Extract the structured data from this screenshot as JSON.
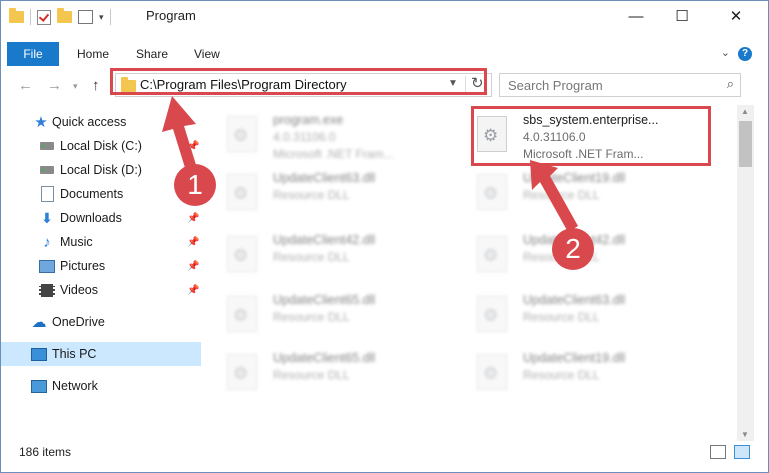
{
  "window": {
    "title": "Program",
    "minimize": "—",
    "maximize": "☐",
    "close": "✕"
  },
  "ribbon": {
    "file": "File",
    "tabs": [
      "Home",
      "Share",
      "View"
    ],
    "help": "?",
    "collapse": "⌄"
  },
  "address": {
    "path": "C:\\Program Files\\Program Directory",
    "search_placeholder": "Search Program"
  },
  "nav": {
    "items": [
      {
        "label": "Quick access"
      },
      {
        "label": "Local Disk (C:)"
      },
      {
        "label": "Local Disk (D:)"
      },
      {
        "label": "Documents"
      },
      {
        "label": "Downloads"
      },
      {
        "label": "Music"
      },
      {
        "label": "Pictures"
      },
      {
        "label": "Videos"
      },
      {
        "label": "OneDrive"
      },
      {
        "label": "This PC"
      },
      {
        "label": "Network"
      }
    ]
  },
  "files": [
    {
      "name": "program.exe",
      "line1": "4.0.31106.0",
      "line2": "Microsoft .NET Fram..."
    },
    {
      "name": "sbs_system.enterprise...",
      "line1": "4.0.31106.0",
      "line2": "Microsoft .NET Fram..."
    },
    {
      "name": "UpdateClient63.dll",
      "line1": "Resource DLL"
    },
    {
      "name": "UpdateClient19.dll",
      "line1": "Resource DLL"
    },
    {
      "name": "UpdateClient42.dll",
      "line1": "Resource DLL"
    },
    {
      "name": "UpdateClient42.dll",
      "line1": "Resource DLL"
    },
    {
      "name": "UpdateClient65.dll",
      "line1": "Resource DLL"
    },
    {
      "name": "UpdateClient63.dll",
      "line1": "Resource DLL"
    },
    {
      "name": "UpdateClient65.dll",
      "line1": "Resource DLL"
    },
    {
      "name": "UpdateClient19.dll",
      "line1": "Resource DLL"
    }
  ],
  "status": {
    "count": "186 items"
  },
  "annotations": {
    "badge1": "1",
    "badge2": "2",
    "color": "#d9484d"
  }
}
